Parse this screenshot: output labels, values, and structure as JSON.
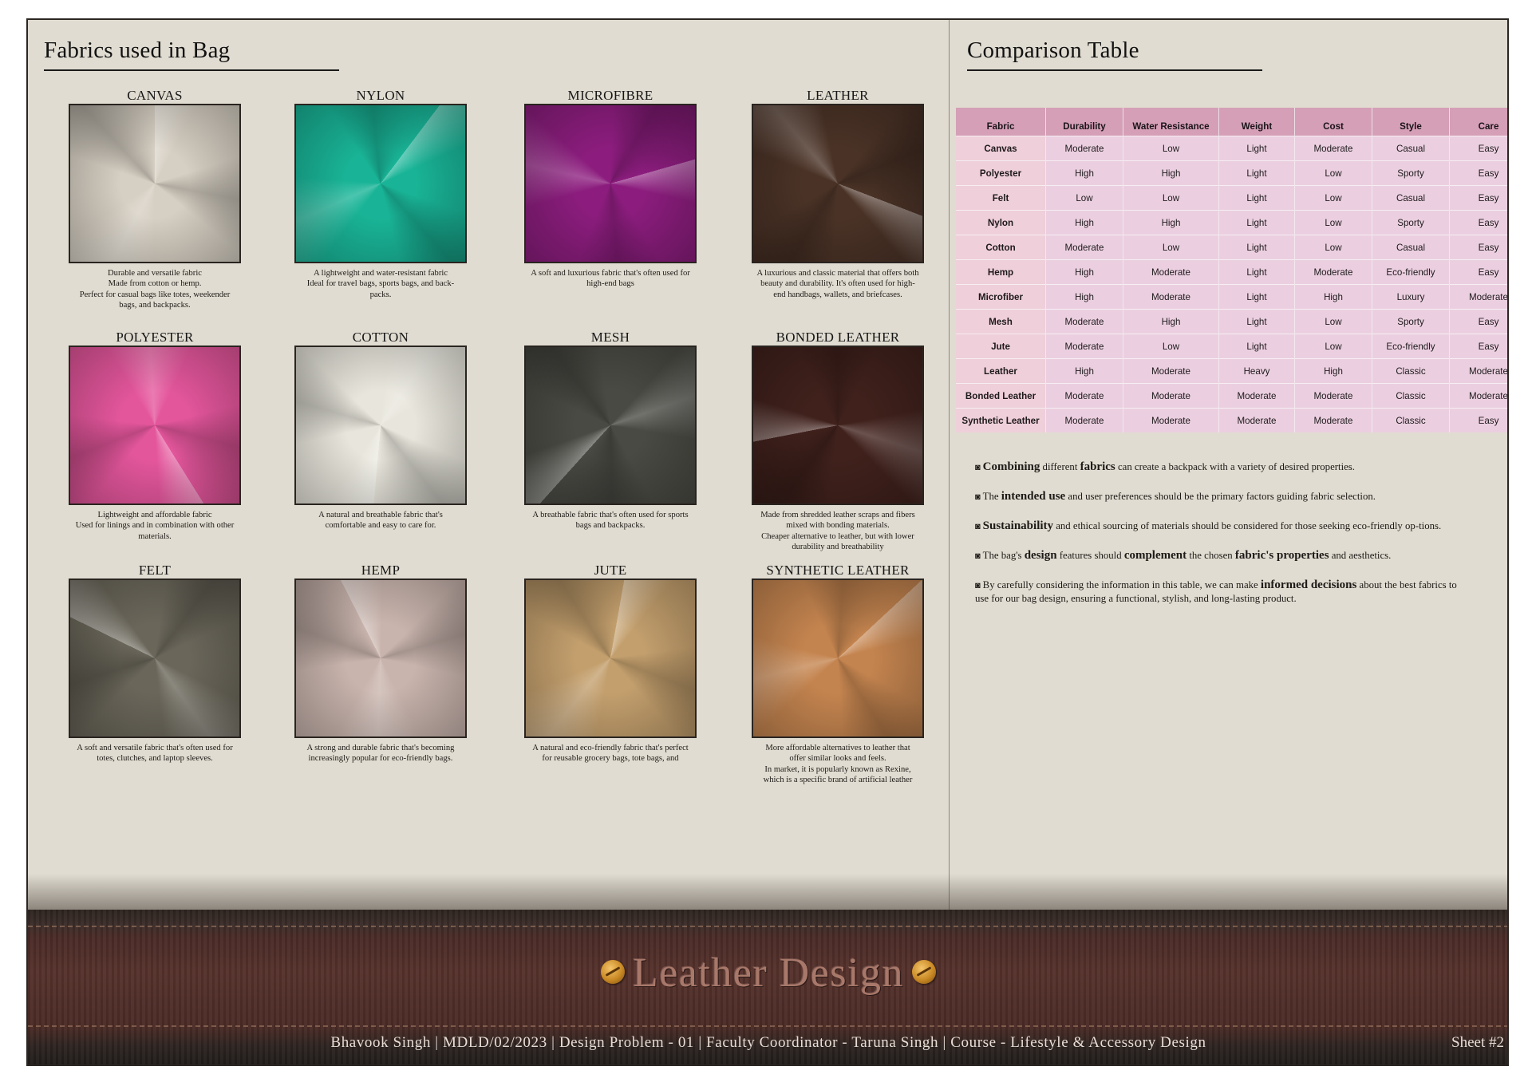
{
  "left": {
    "title": "Fabrics used in Bag",
    "fabrics": [
      {
        "name": "CANVAS",
        "description": "Durable and versatile fabric\nMade from cotton or hemp.\nPerfect for casual bags like totes, weekender bags, and backpacks.",
        "swatch_color": "#d6cfc3"
      },
      {
        "name": "NYLON",
        "description": "A lightweight and water-resistant fabric\nIdeal for travel bags, sports bags, and back-packs.",
        "swatch_color": "#19b497"
      },
      {
        "name": "MICROFIBRE",
        "description": "A soft and luxurious fabric that's often used for high-end bags",
        "swatch_color": "#8c1d7e"
      },
      {
        "name": "LEATHER",
        "description": "A luxurious and classic material that offers both beauty and durability. It's often used for high-end handbags, wallets, and briefcases.",
        "swatch_color": "#4a3226"
      },
      {
        "name": "POLYESTER",
        "description": "Lightweight and affordable fabric\nUsed for linings and in combination with other materials.",
        "swatch_color": "#e4569c"
      },
      {
        "name": "COTTON",
        "description": "A natural and breathable fabric that's comfortable and easy to care for.",
        "swatch_color": "#e8e6dc"
      },
      {
        "name": "MESH",
        "description": "A breathable fabric that's often used for sports bags and backpacks.",
        "swatch_color": "#4a4a44"
      },
      {
        "name": "BONDED LEATHER",
        "description": "Made from shredded leather scraps and fibers mixed with bonding materials.\nCheaper alternative to leather, but with lower durability and breathability",
        "swatch_color": "#40211c"
      },
      {
        "name": "FELT",
        "description": "A soft and versatile fabric that's often used for totes, clutches, and laptop sleeves.",
        "swatch_color": "#6a665a"
      },
      {
        "name": "HEMP",
        "description": "A strong and durable fabric that's becoming increasingly popular for eco-friendly bags.",
        "swatch_color": "#c9b4ad"
      },
      {
        "name": "JUTE",
        "description": "A natural and eco-friendly fabric that's perfect for reusable grocery bags, tote bags, and",
        "swatch_color": "#c39f6d"
      },
      {
        "name": "SYNTHETIC LEATHER",
        "description": "More affordable alternatives to leather that offer similar looks and feels.\nIn market, it is popularly known as Rexine, which is a specific brand of artificial leather",
        "swatch_color": "#c4844f"
      }
    ]
  },
  "right": {
    "title": "Comparison Table",
    "table": {
      "headers": [
        "Fabric",
        "Durability",
        "Water Resistance",
        "Weight",
        "Cost",
        "Style",
        "Care"
      ],
      "rows": [
        [
          "Canvas",
          "Moderate",
          "Low",
          "Light",
          "Moderate",
          "Casual",
          "Easy"
        ],
        [
          "Polyester",
          "High",
          "High",
          "Light",
          "Low",
          "Sporty",
          "Easy"
        ],
        [
          "Felt",
          "Low",
          "Low",
          "Light",
          "Low",
          "Casual",
          "Easy"
        ],
        [
          "Nylon",
          "High",
          "High",
          "Light",
          "Low",
          "Sporty",
          "Easy"
        ],
        [
          "Cotton",
          "Moderate",
          "Low",
          "Light",
          "Low",
          "Casual",
          "Easy"
        ],
        [
          "Hemp",
          "High",
          "Moderate",
          "Light",
          "Moderate",
          "Eco-friendly",
          "Easy"
        ],
        [
          "Microfiber",
          "High",
          "Moderate",
          "Light",
          "High",
          "Luxury",
          "Moderate"
        ],
        [
          "Mesh",
          "Moderate",
          "High",
          "Light",
          "Low",
          "Sporty",
          "Easy"
        ],
        [
          "Jute",
          "Moderate",
          "Low",
          "Light",
          "Low",
          "Eco-friendly",
          "Easy"
        ],
        [
          "Leather",
          "High",
          "Moderate",
          "Heavy",
          "High",
          "Classic",
          "Moderate"
        ],
        [
          "Bonded Leather",
          "Moderate",
          "Moderate",
          "Moderate",
          "Moderate",
          "Classic",
          "Moderate"
        ],
        [
          "Synthetic Leather",
          "Moderate",
          "Moderate",
          "Moderate",
          "Moderate",
          "Classic",
          "Easy"
        ]
      ]
    },
    "notes": [
      {
        "t1": "",
        "b1": "Combining",
        "t2": " different ",
        "b2": "fabrics",
        "t3": " can create a backpack with a variety of desired properties.",
        "b3": "",
        "t4": ""
      },
      {
        "t1": "The ",
        "b1": "intended use",
        "t2": " and user preferences should be the primary factors guiding fabric selection.",
        "b2": "",
        "t3": "",
        "b3": "",
        "t4": ""
      },
      {
        "t1": "",
        "b1": "Sustainability",
        "t2": " and ethical sourcing of materials should be considered for those seeking eco-friendly op-tions.",
        "b2": "",
        "t3": "",
        "b3": "",
        "t4": ""
      },
      {
        "t1": "The bag's ",
        "b1": "design",
        "t2": " features should ",
        "b2": "complement",
        "t3": " the chosen ",
        "b3": "fabric's properties",
        "t4": " and aesthetics."
      },
      {
        "t1": "By carefully considering the information in this table, we can make ",
        "b1": "informed decisions",
        "t2": " about the best fabrics to use for our bag design, ensuring a functional, stylish, and long-lasting product.",
        "b2": "",
        "t3": "",
        "b3": "",
        "t4": ""
      }
    ]
  },
  "footer": {
    "brand": "Leather Design",
    "credits": "Bhavook Singh | MDLD/02/2023 | Design Problem  - 01 | Faculty Coordinator - Taruna Singh | Course - Lifestyle & Accessory Design",
    "sheet": "Sheet #2",
    "brand_icon": "button-icon"
  }
}
